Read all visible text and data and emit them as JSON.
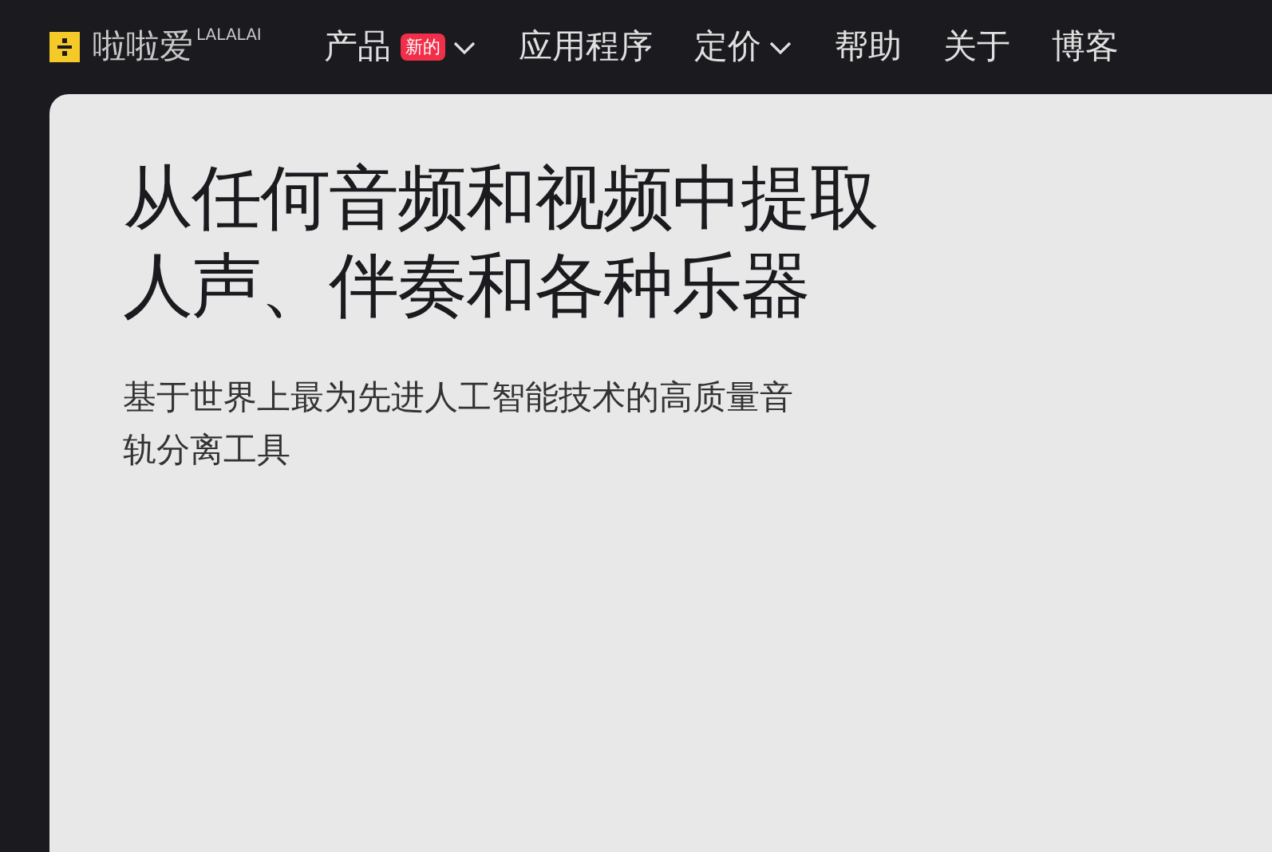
{
  "logo": {
    "name": "啦啦爱",
    "tag": "LALALAI"
  },
  "nav": [
    {
      "label": "产品",
      "badge": "新的",
      "has_caret": true
    },
    {
      "label": "应用程序",
      "has_caret": false
    },
    {
      "label": "定价",
      "has_caret": true
    },
    {
      "label": "帮助",
      "has_caret": false
    },
    {
      "label": "关于",
      "has_caret": false
    },
    {
      "label": "博客",
      "has_caret": false
    }
  ],
  "hero": {
    "title": "从任何音频和视频中提取人声、伴奏和各种乐器",
    "subtitle": "基于世界上最为先进人工智能技术的高质量音轨分离工具"
  }
}
